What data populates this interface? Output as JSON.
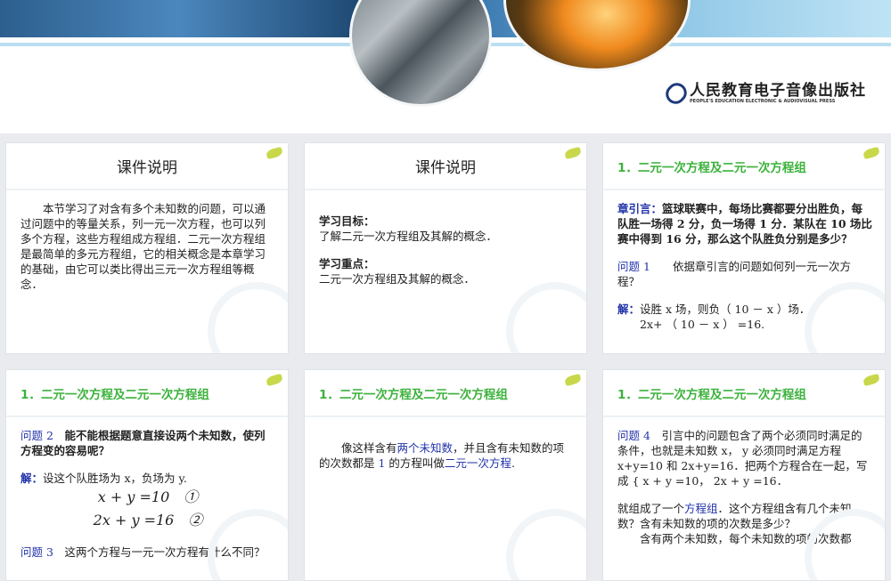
{
  "header": {
    "publisher_cn": "人民教育电子音像出版社",
    "publisher_en": "PEOPLE'S EDUCATION ELECTRONIC & AUDIOVISUAL PRESS"
  },
  "slides": [
    {
      "title": "课件说明",
      "title_style": "center",
      "lines": [
        {
          "cls": "indent",
          "segs": [
            {
              "t": "本节学习了对含有多个未知数的问题，可以通过问题中的等量关系，列一元一次方程，也可以列多个方程，这些方程组成方程组．二元一次方程组是最简单的多元方程组，它的相关概念是本章学习的基础，由它可以类比得出三元一次方程组等概念．"
            }
          ]
        }
      ]
    },
    {
      "title": "课件说明",
      "title_style": "center",
      "lines": [
        {
          "cls": "gap",
          "segs": []
        },
        {
          "segs": [
            {
              "t": "学习目标：",
              "c": "bold"
            }
          ]
        },
        {
          "segs": [
            {
              "t": "了解二元一次方程组及其解的概念．"
            }
          ]
        },
        {
          "cls": "gap",
          "segs": []
        },
        {
          "segs": [
            {
              "t": "学习重点：",
              "c": "bold"
            }
          ]
        },
        {
          "segs": [
            {
              "t": "二元一次方程组及其解的概念．"
            }
          ]
        }
      ]
    },
    {
      "title": "1．二元一次方程及二元一次方程组",
      "title_style": "green",
      "lines": [
        {
          "segs": [
            {
              "t": "章引言：",
              "c": "blue bold"
            },
            {
              "t": "篮球联赛中，每场比赛都要分出胜负，每队胜一场得 2 分，负一场得 1 分．某队在 10 场比赛中得到 16 分，那么这个队胜负分别是多少？",
              "c": "bold"
            }
          ]
        },
        {
          "cls": "gap",
          "segs": []
        },
        {
          "segs": [
            {
              "t": "问题 1",
              "c": "blue"
            },
            {
              "t": "　　依据章引言的问题如何列一元一次方程？"
            }
          ]
        },
        {
          "cls": "gap",
          "segs": []
        },
        {
          "segs": [
            {
              "t": "解：",
              "c": "blue bold"
            },
            {
              "t": "设胜 x 场，则负（ 10 － x ）场．"
            }
          ]
        },
        {
          "cls": "indent",
          "segs": [
            {
              "t": "2x+ （ 10 － x ） =16."
            }
          ]
        }
      ]
    },
    {
      "title": "1．二元一次方程及二元一次方程组",
      "title_style": "green",
      "lines": [
        {
          "segs": [
            {
              "t": "问题 2",
              "c": "blue"
            },
            {
              "t": "　能不能根据题意直接设两个未知数，使列方程变的容易呢？",
              "c": "bold"
            }
          ]
        },
        {
          "cls": "gap",
          "segs": []
        },
        {
          "segs": [
            {
              "t": "解：",
              "c": "blue bold"
            },
            {
              "t": "设这个队胜场为 x，负场为 y."
            }
          ]
        },
        {
          "cls": "eq",
          "segs": [
            {
              "t": "x + y =10　①"
            }
          ]
        },
        {
          "cls": "eq",
          "segs": [
            {
              "t": "2x + y =16　②"
            }
          ]
        },
        {
          "cls": "gap",
          "segs": []
        },
        {
          "segs": [
            {
              "t": "问题 3",
              "c": "blue"
            },
            {
              "t": "　这两个方程与一元一次方程有什么不同？"
            }
          ]
        }
      ]
    },
    {
      "title": "1．二元一次方程及二元一次方程组",
      "title_style": "green",
      "lines": [
        {
          "cls": "gap",
          "segs": []
        },
        {
          "cls": "indent",
          "segs": [
            {
              "t": "像这样含有"
            },
            {
              "t": "两个未知数",
              "c": "blue"
            },
            {
              "t": "，并且含有未知数的项的次数都是 "
            },
            {
              "t": "1",
              "c": "blue"
            },
            {
              "t": " 的方程叫做"
            },
            {
              "t": "二元一次方程",
              "c": "blue"
            },
            {
              "t": "."
            }
          ]
        }
      ]
    },
    {
      "title": "1．二元一次方程及二元一次方程组",
      "title_style": "green",
      "lines": [
        {
          "segs": [
            {
              "t": "问题 4",
              "c": "blue"
            },
            {
              "t": "　引言中的问题包含了两个必须同时满足的条件，也就是未知数 x， y 必须同时满足方程 x+y=10 和 2x+y=16．把两个方程合在一起，写成 { x + y =10， 2x + y =16．"
            }
          ]
        },
        {
          "cls": "gap",
          "segs": []
        },
        {
          "segs": [
            {
              "t": "就组成了一个"
            },
            {
              "t": "方程组",
              "c": "blue"
            },
            {
              "t": "．这个方程组含有几个未知数？含有未知数的项的次数是多少？"
            }
          ]
        },
        {
          "cls": "indent",
          "segs": [
            {
              "t": "含有两个未知数，每个未知数的项的次数都"
            }
          ]
        }
      ]
    }
  ]
}
